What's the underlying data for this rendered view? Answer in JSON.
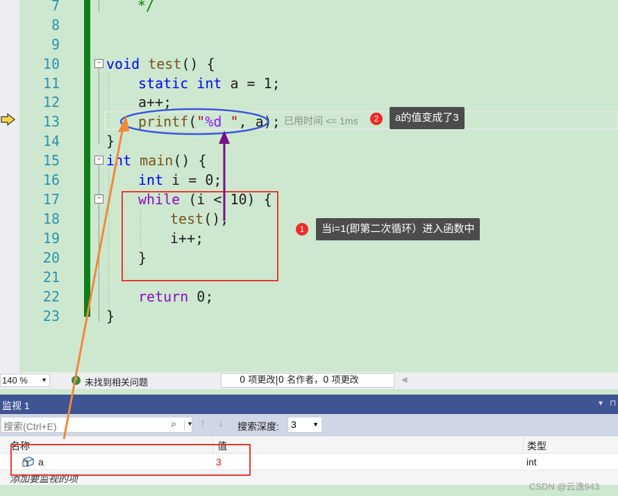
{
  "editor": {
    "lines": [
      {
        "num": "7"
      },
      {
        "num": "8"
      },
      {
        "num": "9"
      },
      {
        "num": "10"
      },
      {
        "num": "11"
      },
      {
        "num": "12"
      },
      {
        "num": "13"
      },
      {
        "num": "14"
      },
      {
        "num": "15"
      },
      {
        "num": "16"
      },
      {
        "num": "17"
      },
      {
        "num": "18"
      },
      {
        "num": "19"
      },
      {
        "num": "20"
      },
      {
        "num": "21"
      },
      {
        "num": "22"
      },
      {
        "num": "23"
      }
    ],
    "code": {
      "l7": "*/",
      "l10_kw": "void",
      "l10_fn": "test",
      "l10_rest": "() {",
      "l11_static": "static",
      "l11_int": "int",
      "l11_rest": " a = 1;",
      "l12": "a++;",
      "l13_fn": "printf",
      "l13_open": "(",
      "l13_q1": "\"",
      "l13_ph": "%d",
      "l13_q2": " \"",
      "l13_rest": ", a);",
      "l14": "}",
      "l15_kw": "int",
      "l15_fn": "main",
      "l15_rest": "() {",
      "l16_kw": "int",
      "l16_rest": " i = 0;",
      "l17_kw": "while",
      "l17_rest": " (i < 10) {",
      "l18_fn": "test",
      "l18_rest": "();",
      "l19": "i++;",
      "l20": "}",
      "l22_kw": "return",
      "l22_rest": " 0;",
      "l23": "}"
    },
    "fold_glyph": "−",
    "elapsed": "已用时间 <= 1ms"
  },
  "annotations": {
    "badge1": "1",
    "tip1": "当i=1(即第二次循环）进入函数中",
    "badge2": "2",
    "tip2": "a的值变成了3",
    "colors": {
      "red_box": "#e53935",
      "blue_ellipse": "#3a57d8",
      "purple_arrow": "#7a0e88",
      "orange_arrow": "#f0883a"
    }
  },
  "status": {
    "zoom": "140 %",
    "issues": "未找到相关问题",
    "changes": "0 项更改|0 名作者，0 项更改"
  },
  "watch": {
    "title": "监视 1",
    "pin": "▾ ⊓",
    "search_placeholder": "搜索(Ctrl+E)",
    "depth_label": "搜索深度:",
    "depth_value": "3",
    "columns": {
      "name": "名称",
      "value": "值",
      "type": "类型"
    },
    "rows": [
      {
        "name": "a",
        "value": "3",
        "type": "int"
      }
    ],
    "add_hint": "添加要监视的项"
  },
  "watermark": "CSDN @云逸943"
}
